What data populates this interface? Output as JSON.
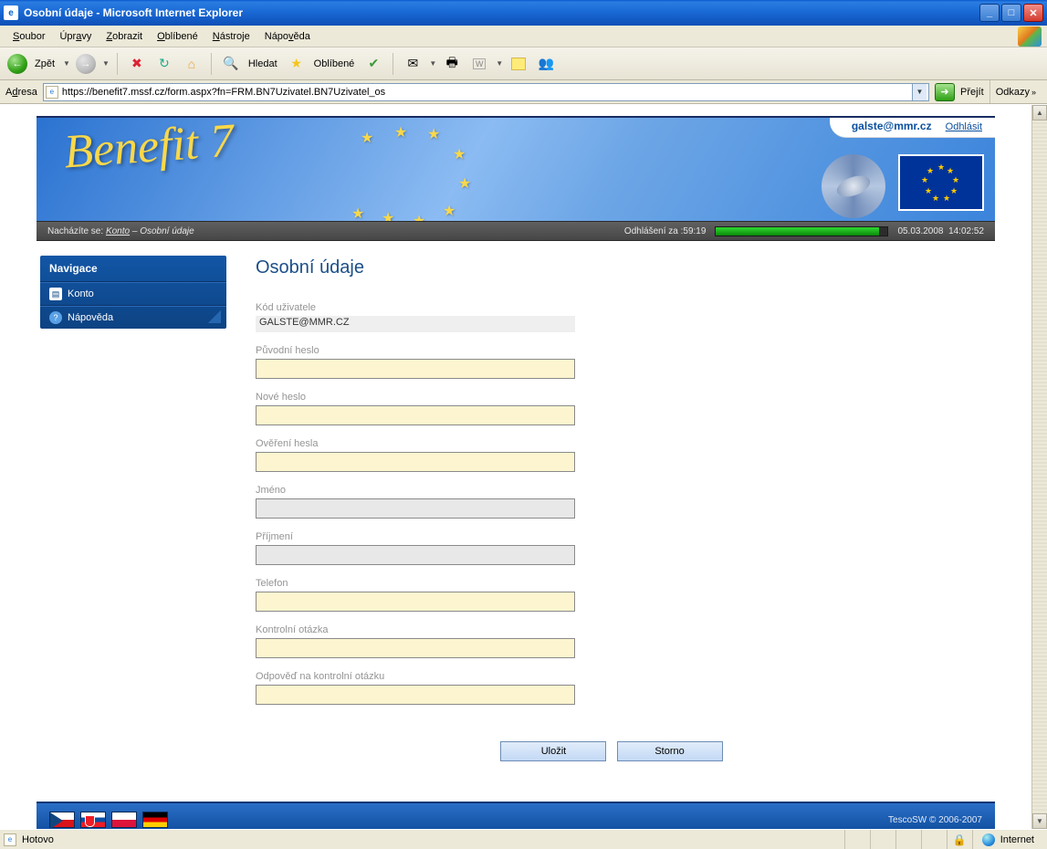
{
  "window": {
    "title": "Osobní údaje - Microsoft Internet Explorer"
  },
  "menu": {
    "soubor": "Soubor",
    "upravy": "Úpravy",
    "zobrazit": "Zobrazit",
    "oblibene": "Oblíbené",
    "nastroje": "Nástroje",
    "napoveda": "Nápověda"
  },
  "toolbar": {
    "back": "Zpět",
    "search": "Hledat",
    "favorites": "Oblíbené"
  },
  "address": {
    "label": "Adresa",
    "url": "https://benefit7.mssf.cz/form.aspx?fn=FRM.BN7Uzivatel.BN7Uzivatel_os",
    "go": "Přejít",
    "links": "Odkazy"
  },
  "userbar": {
    "email": "galste@mmr.cz",
    "logout": "Odhlásit"
  },
  "breadcrumb": {
    "prefix": "Nacházíte se:",
    "konto": "Konto",
    "sep": "–",
    "page": "Osobní údaje",
    "logout_label": "Odhlášení za :",
    "logout_time": "59:19",
    "date": "05.03.2008",
    "time": "14:02:52"
  },
  "nav": {
    "title": "Navigace",
    "items": [
      {
        "label": "Konto"
      },
      {
        "label": "Nápověda"
      }
    ]
  },
  "form": {
    "heading": "Osobní údaje",
    "user_code_label": "Kód uživatele",
    "user_code_value": "GALSTE@MMR.CZ",
    "old_pw_label": "Původní heslo",
    "new_pw_label": "Nové heslo",
    "confirm_pw_label": "Ověření hesla",
    "firstname_label": "Jméno",
    "lastname_label": "Příjmení",
    "phone_label": "Telefon",
    "question_label": "Kontrolní otázka",
    "answer_label": "Odpověď na kontrolní otázku",
    "save": "Uložit",
    "cancel": "Storno"
  },
  "footer": {
    "copy": "TescoSW © 2006-2007"
  },
  "status": {
    "text": "Hotovo",
    "zone": "Internet"
  }
}
